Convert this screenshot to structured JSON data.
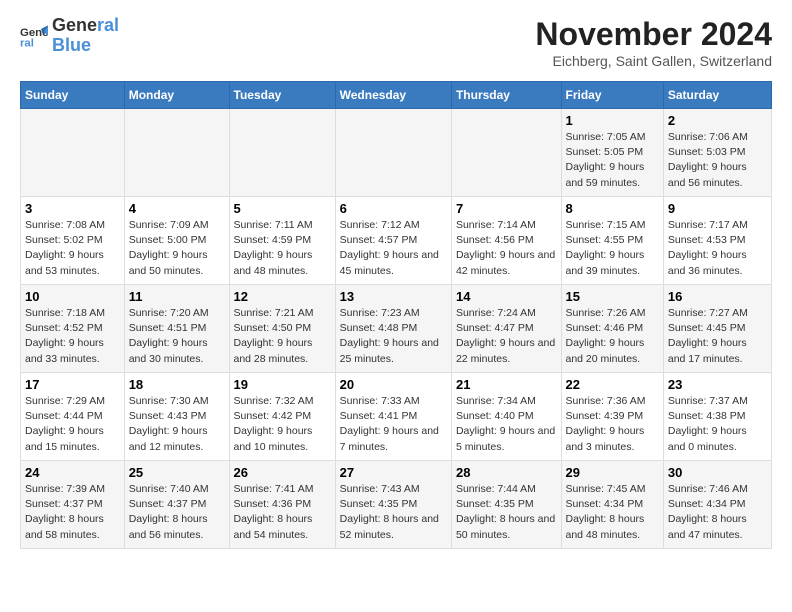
{
  "logo": {
    "line1": "General",
    "line2": "Blue"
  },
  "title": "November 2024",
  "subtitle": "Eichberg, Saint Gallen, Switzerland",
  "weekdays": [
    "Sunday",
    "Monday",
    "Tuesday",
    "Wednesday",
    "Thursday",
    "Friday",
    "Saturday"
  ],
  "weeks": [
    [
      {
        "day": "",
        "sunrise": "",
        "sunset": "",
        "daylight": ""
      },
      {
        "day": "",
        "sunrise": "",
        "sunset": "",
        "daylight": ""
      },
      {
        "day": "",
        "sunrise": "",
        "sunset": "",
        "daylight": ""
      },
      {
        "day": "",
        "sunrise": "",
        "sunset": "",
        "daylight": ""
      },
      {
        "day": "",
        "sunrise": "",
        "sunset": "",
        "daylight": ""
      },
      {
        "day": "1",
        "sunrise": "Sunrise: 7:05 AM",
        "sunset": "Sunset: 5:05 PM",
        "daylight": "Daylight: 9 hours and 59 minutes."
      },
      {
        "day": "2",
        "sunrise": "Sunrise: 7:06 AM",
        "sunset": "Sunset: 5:03 PM",
        "daylight": "Daylight: 9 hours and 56 minutes."
      }
    ],
    [
      {
        "day": "3",
        "sunrise": "Sunrise: 7:08 AM",
        "sunset": "Sunset: 5:02 PM",
        "daylight": "Daylight: 9 hours and 53 minutes."
      },
      {
        "day": "4",
        "sunrise": "Sunrise: 7:09 AM",
        "sunset": "Sunset: 5:00 PM",
        "daylight": "Daylight: 9 hours and 50 minutes."
      },
      {
        "day": "5",
        "sunrise": "Sunrise: 7:11 AM",
        "sunset": "Sunset: 4:59 PM",
        "daylight": "Daylight: 9 hours and 48 minutes."
      },
      {
        "day": "6",
        "sunrise": "Sunrise: 7:12 AM",
        "sunset": "Sunset: 4:57 PM",
        "daylight": "Daylight: 9 hours and 45 minutes."
      },
      {
        "day": "7",
        "sunrise": "Sunrise: 7:14 AM",
        "sunset": "Sunset: 4:56 PM",
        "daylight": "Daylight: 9 hours and 42 minutes."
      },
      {
        "day": "8",
        "sunrise": "Sunrise: 7:15 AM",
        "sunset": "Sunset: 4:55 PM",
        "daylight": "Daylight: 9 hours and 39 minutes."
      },
      {
        "day": "9",
        "sunrise": "Sunrise: 7:17 AM",
        "sunset": "Sunset: 4:53 PM",
        "daylight": "Daylight: 9 hours and 36 minutes."
      }
    ],
    [
      {
        "day": "10",
        "sunrise": "Sunrise: 7:18 AM",
        "sunset": "Sunset: 4:52 PM",
        "daylight": "Daylight: 9 hours and 33 minutes."
      },
      {
        "day": "11",
        "sunrise": "Sunrise: 7:20 AM",
        "sunset": "Sunset: 4:51 PM",
        "daylight": "Daylight: 9 hours and 30 minutes."
      },
      {
        "day": "12",
        "sunrise": "Sunrise: 7:21 AM",
        "sunset": "Sunset: 4:50 PM",
        "daylight": "Daylight: 9 hours and 28 minutes."
      },
      {
        "day": "13",
        "sunrise": "Sunrise: 7:23 AM",
        "sunset": "Sunset: 4:48 PM",
        "daylight": "Daylight: 9 hours and 25 minutes."
      },
      {
        "day": "14",
        "sunrise": "Sunrise: 7:24 AM",
        "sunset": "Sunset: 4:47 PM",
        "daylight": "Daylight: 9 hours and 22 minutes."
      },
      {
        "day": "15",
        "sunrise": "Sunrise: 7:26 AM",
        "sunset": "Sunset: 4:46 PM",
        "daylight": "Daylight: 9 hours and 20 minutes."
      },
      {
        "day": "16",
        "sunrise": "Sunrise: 7:27 AM",
        "sunset": "Sunset: 4:45 PM",
        "daylight": "Daylight: 9 hours and 17 minutes."
      }
    ],
    [
      {
        "day": "17",
        "sunrise": "Sunrise: 7:29 AM",
        "sunset": "Sunset: 4:44 PM",
        "daylight": "Daylight: 9 hours and 15 minutes."
      },
      {
        "day": "18",
        "sunrise": "Sunrise: 7:30 AM",
        "sunset": "Sunset: 4:43 PM",
        "daylight": "Daylight: 9 hours and 12 minutes."
      },
      {
        "day": "19",
        "sunrise": "Sunrise: 7:32 AM",
        "sunset": "Sunset: 4:42 PM",
        "daylight": "Daylight: 9 hours and 10 minutes."
      },
      {
        "day": "20",
        "sunrise": "Sunrise: 7:33 AM",
        "sunset": "Sunset: 4:41 PM",
        "daylight": "Daylight: 9 hours and 7 minutes."
      },
      {
        "day": "21",
        "sunrise": "Sunrise: 7:34 AM",
        "sunset": "Sunset: 4:40 PM",
        "daylight": "Daylight: 9 hours and 5 minutes."
      },
      {
        "day": "22",
        "sunrise": "Sunrise: 7:36 AM",
        "sunset": "Sunset: 4:39 PM",
        "daylight": "Daylight: 9 hours and 3 minutes."
      },
      {
        "day": "23",
        "sunrise": "Sunrise: 7:37 AM",
        "sunset": "Sunset: 4:38 PM",
        "daylight": "Daylight: 9 hours and 0 minutes."
      }
    ],
    [
      {
        "day": "24",
        "sunrise": "Sunrise: 7:39 AM",
        "sunset": "Sunset: 4:37 PM",
        "daylight": "Daylight: 8 hours and 58 minutes."
      },
      {
        "day": "25",
        "sunrise": "Sunrise: 7:40 AM",
        "sunset": "Sunset: 4:37 PM",
        "daylight": "Daylight: 8 hours and 56 minutes."
      },
      {
        "day": "26",
        "sunrise": "Sunrise: 7:41 AM",
        "sunset": "Sunset: 4:36 PM",
        "daylight": "Daylight: 8 hours and 54 minutes."
      },
      {
        "day": "27",
        "sunrise": "Sunrise: 7:43 AM",
        "sunset": "Sunset: 4:35 PM",
        "daylight": "Daylight: 8 hours and 52 minutes."
      },
      {
        "day": "28",
        "sunrise": "Sunrise: 7:44 AM",
        "sunset": "Sunset: 4:35 PM",
        "daylight": "Daylight: 8 hours and 50 minutes."
      },
      {
        "day": "29",
        "sunrise": "Sunrise: 7:45 AM",
        "sunset": "Sunset: 4:34 PM",
        "daylight": "Daylight: 8 hours and 48 minutes."
      },
      {
        "day": "30",
        "sunrise": "Sunrise: 7:46 AM",
        "sunset": "Sunset: 4:34 PM",
        "daylight": "Daylight: 8 hours and 47 minutes."
      }
    ]
  ]
}
